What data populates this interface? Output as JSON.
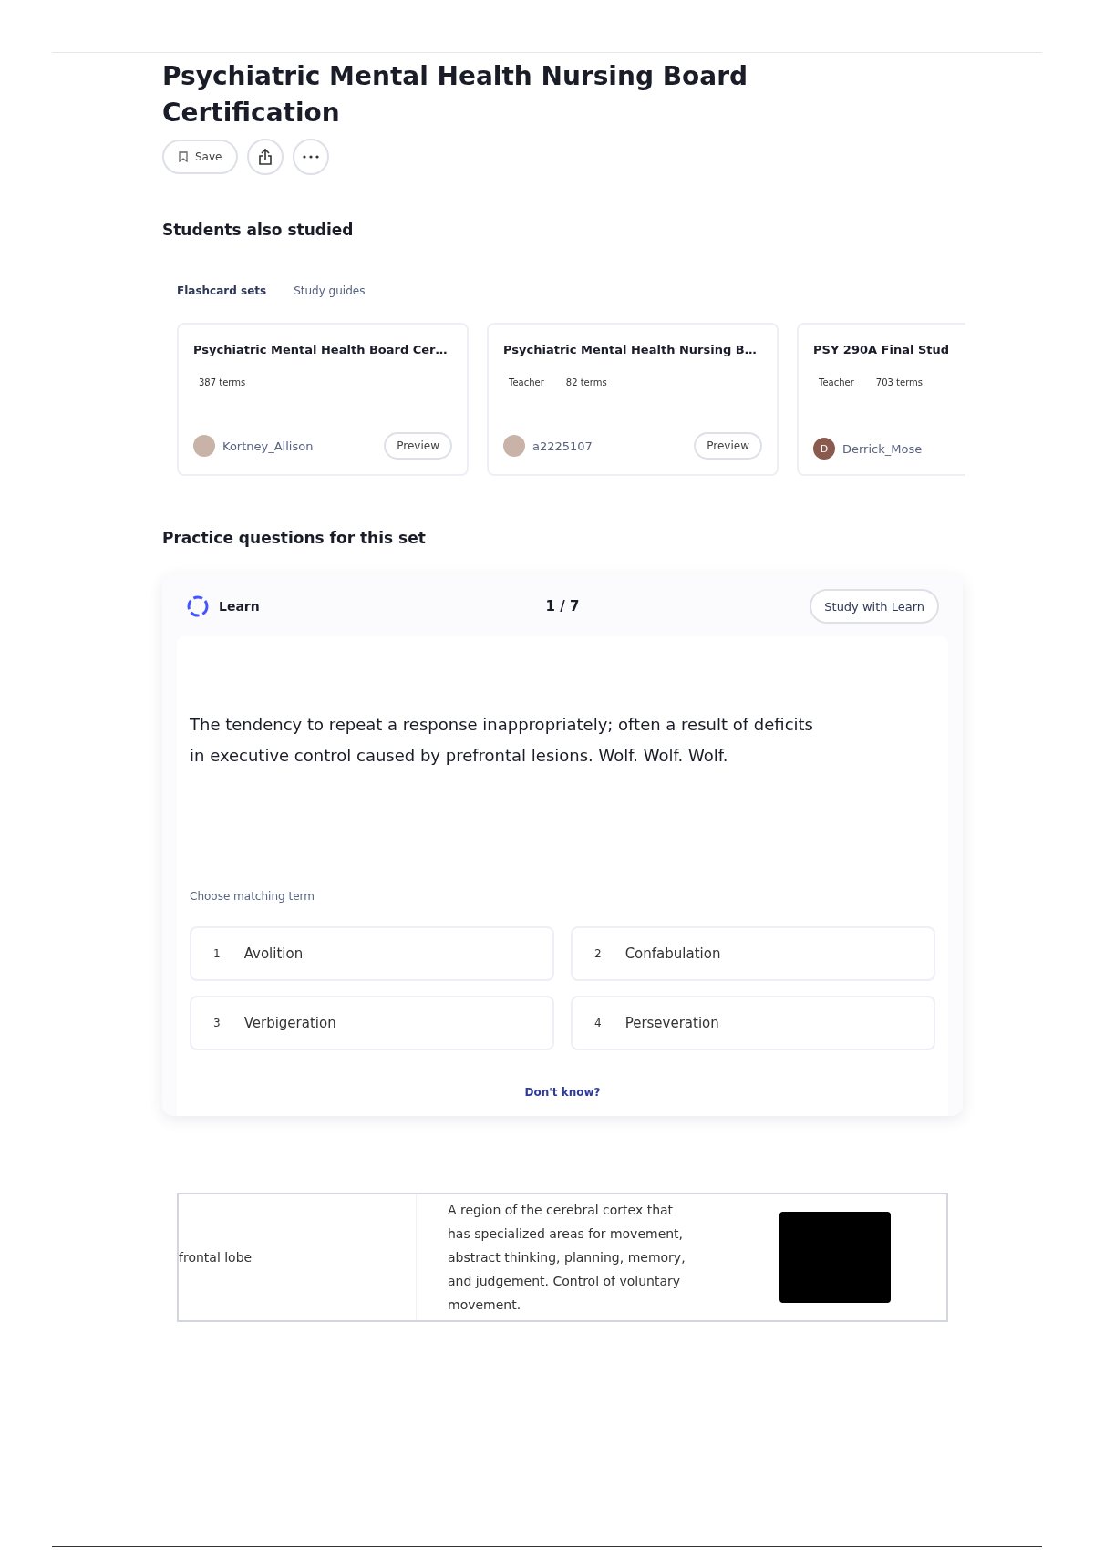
{
  "title": "Psychiatric Mental Health Nursing Board Certification",
  "actions": {
    "save": "Save"
  },
  "also_studied": {
    "heading": "Students also studied",
    "tabs": [
      {
        "label": "Flashcard sets",
        "selected": true
      },
      {
        "label": "Study guides",
        "selected": false
      }
    ],
    "cards": [
      {
        "title": "Psychiatric Mental Health Board Cer…",
        "meta": [
          "387 terms"
        ],
        "author": "Kortney_Allison",
        "preview": "Preview"
      },
      {
        "title": "Psychiatric Mental Health Nursing B…",
        "meta": [
          "Teacher",
          "82 terms"
        ],
        "author": "a2225107",
        "preview": "Preview"
      },
      {
        "title": "PSY 290A Final Stud",
        "meta": [
          "Teacher",
          "703 terms"
        ],
        "author": "Derrick_Mose",
        "avatar_letter": "D"
      }
    ]
  },
  "practice": {
    "heading": "Practice questions for this set",
    "mode": "Learn",
    "progress": "1 / 7",
    "study_button": "Study with Learn",
    "question": "The tendency to repeat a response inappropriately; often a result of deficits in executive control caused by prefrontal lesions. Wolf. Wolf. Wolf.",
    "prompt": "Choose matching term",
    "options": [
      {
        "number": "1",
        "term": "Avolition"
      },
      {
        "number": "2",
        "term": "Confabulation"
      },
      {
        "number": "3",
        "term": "Verbigeration"
      },
      {
        "number": "4",
        "term": "Perseveration"
      }
    ],
    "dont_know": "Don't know?"
  },
  "terms_table": {
    "rows": [
      {
        "term": "frontal lobe",
        "definition": "A region of the cerebral cortex that has specialized areas for movement, abstract thinking, planning, memory, and judgement. Control of voluntary movement."
      }
    ]
  }
}
